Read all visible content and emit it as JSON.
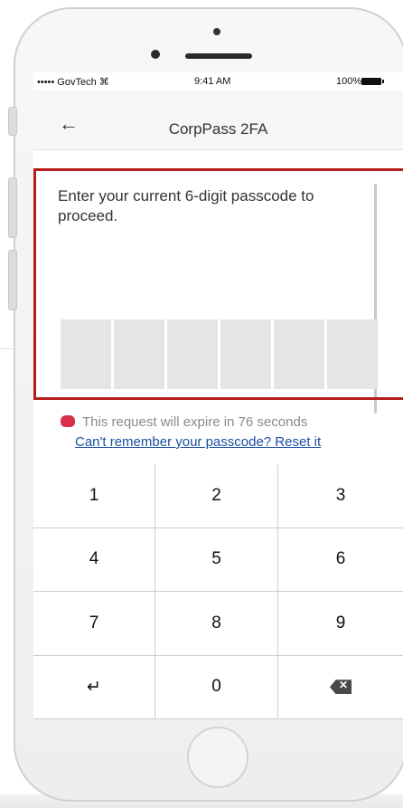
{
  "status_bar": {
    "carrier": "••••• GovTech ⌘",
    "time": "9:41 AM",
    "battery": "100%"
  },
  "nav": {
    "back_icon": "←",
    "title": "CorpPass 2FA"
  },
  "prompt": "Enter your current 6-digit passcode to proceed.",
  "passcode_boxes": [
    "",
    "",
    "",
    "",
    "",
    ""
  ],
  "expiry_text": "This request will expire in 76 seconds",
  "reset_link": "Can't remember your passcode? Reset it",
  "keypad": {
    "keys": [
      "1",
      "2",
      "3",
      "4",
      "5",
      "6",
      "7",
      "8",
      "9",
      "↵",
      "0",
      "⌫"
    ]
  },
  "colors": {
    "highlight": "#b71c1c",
    "link": "#1a4fa3",
    "warning": "#d9304a"
  }
}
